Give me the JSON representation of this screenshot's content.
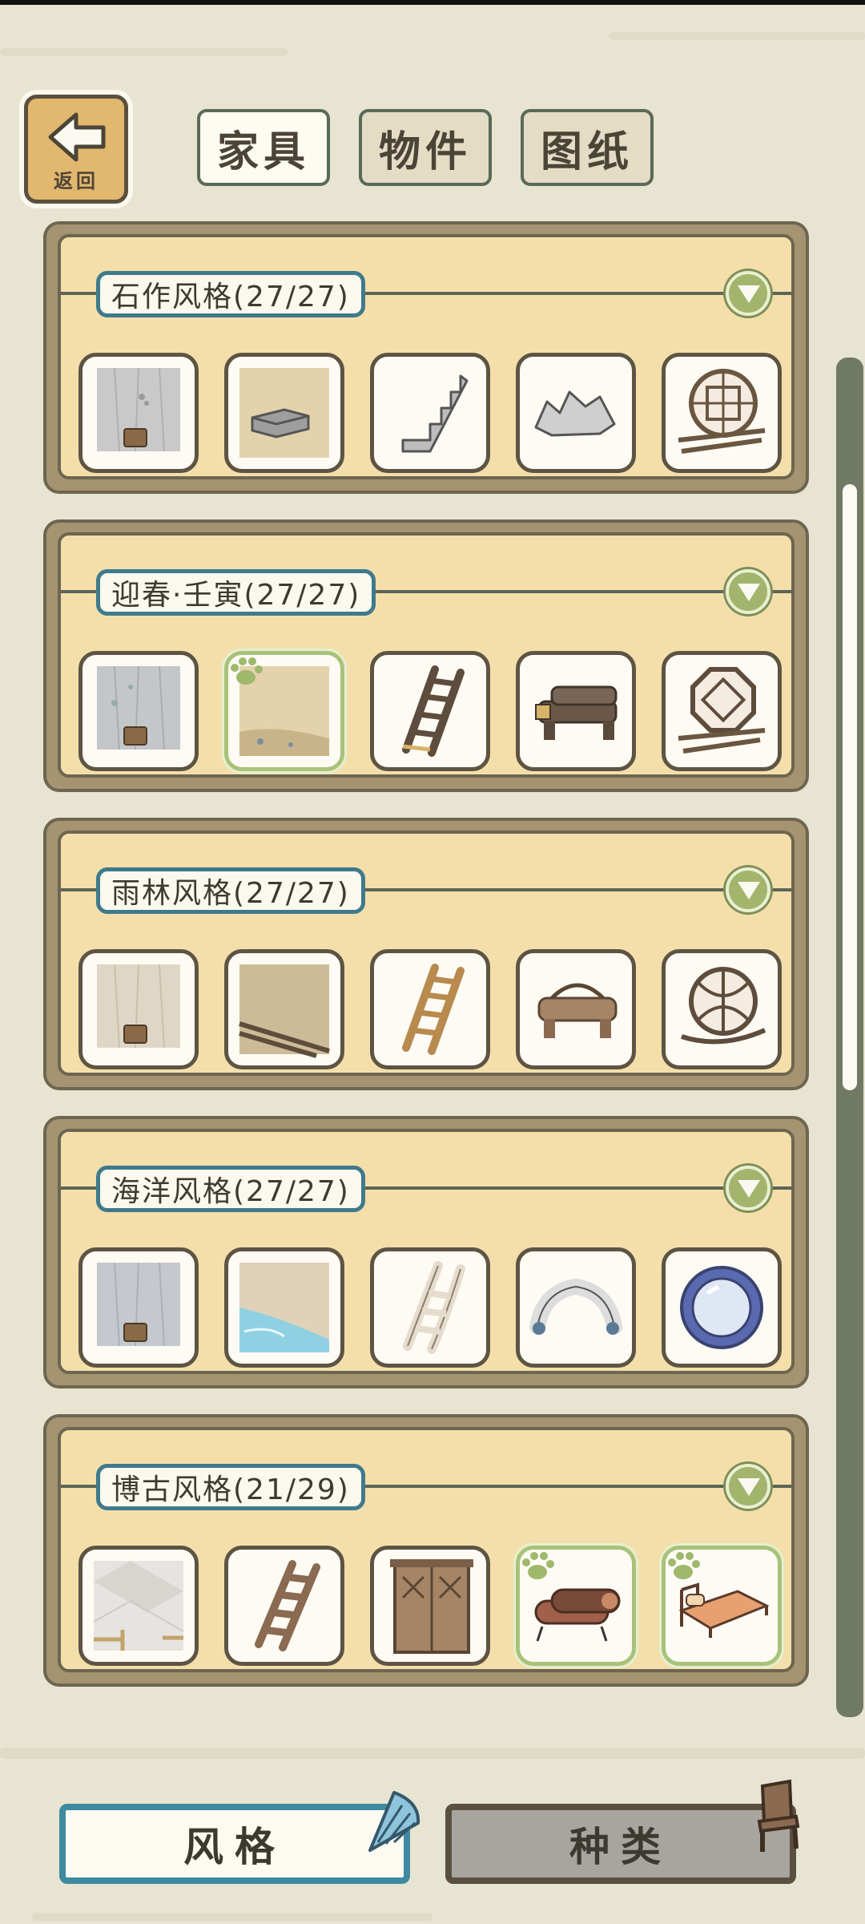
{
  "header": {
    "back_label": "返回",
    "tabs": [
      {
        "label": "家具",
        "active": true
      },
      {
        "label": "物件",
        "active": false
      },
      {
        "label": "图纸",
        "active": false
      }
    ]
  },
  "collections": [
    {
      "title": "石作风格(27/27)",
      "items": [
        {
          "name": "stone-wall-wallpaper",
          "selected": false
        },
        {
          "name": "stone-floor",
          "selected": false
        },
        {
          "name": "stone-stairs",
          "selected": false
        },
        {
          "name": "stone-rock-table",
          "selected": false
        },
        {
          "name": "stone-lattice-window",
          "selected": false
        }
      ]
    },
    {
      "title": "迎春·壬寅(27/27)",
      "items": [
        {
          "name": "spring-wall-wallpaper",
          "selected": false
        },
        {
          "name": "spring-floor",
          "selected": true
        },
        {
          "name": "spring-ladder",
          "selected": false
        },
        {
          "name": "spring-log-table",
          "selected": false
        },
        {
          "name": "spring-octagon-window",
          "selected": false
        }
      ]
    },
    {
      "title": "雨林风格(27/27)",
      "items": [
        {
          "name": "rainforest-wall",
          "selected": false
        },
        {
          "name": "rainforest-floor",
          "selected": false
        },
        {
          "name": "rainforest-ladder",
          "selected": false
        },
        {
          "name": "rainforest-root-table",
          "selected": false
        },
        {
          "name": "rainforest-vine-window",
          "selected": false
        }
      ]
    },
    {
      "title": "海洋风格(27/27)",
      "items": [
        {
          "name": "ocean-wall",
          "selected": false
        },
        {
          "name": "ocean-floor",
          "selected": false
        },
        {
          "name": "ocean-ladder",
          "selected": false
        },
        {
          "name": "ocean-shell-table",
          "selected": false
        },
        {
          "name": "ocean-porthole-window",
          "selected": false
        }
      ]
    },
    {
      "title": "博古风格(21/29)",
      "items": [
        {
          "name": "antique-floor-tiles",
          "selected": false
        },
        {
          "name": "antique-stairs",
          "selected": false
        },
        {
          "name": "antique-door",
          "selected": false
        },
        {
          "name": "antique-scroll-table",
          "selected": true
        },
        {
          "name": "antique-bed",
          "selected": true
        }
      ]
    }
  ],
  "bottom": {
    "style_label": "风格",
    "kind_label": "种类"
  },
  "colors": {
    "background": "#e8e4d2",
    "panel_fill": "#f4dfab",
    "title_border": "#3f7a8c",
    "selected_border": "#a9c27a",
    "expand_button": "#a3b56c"
  }
}
